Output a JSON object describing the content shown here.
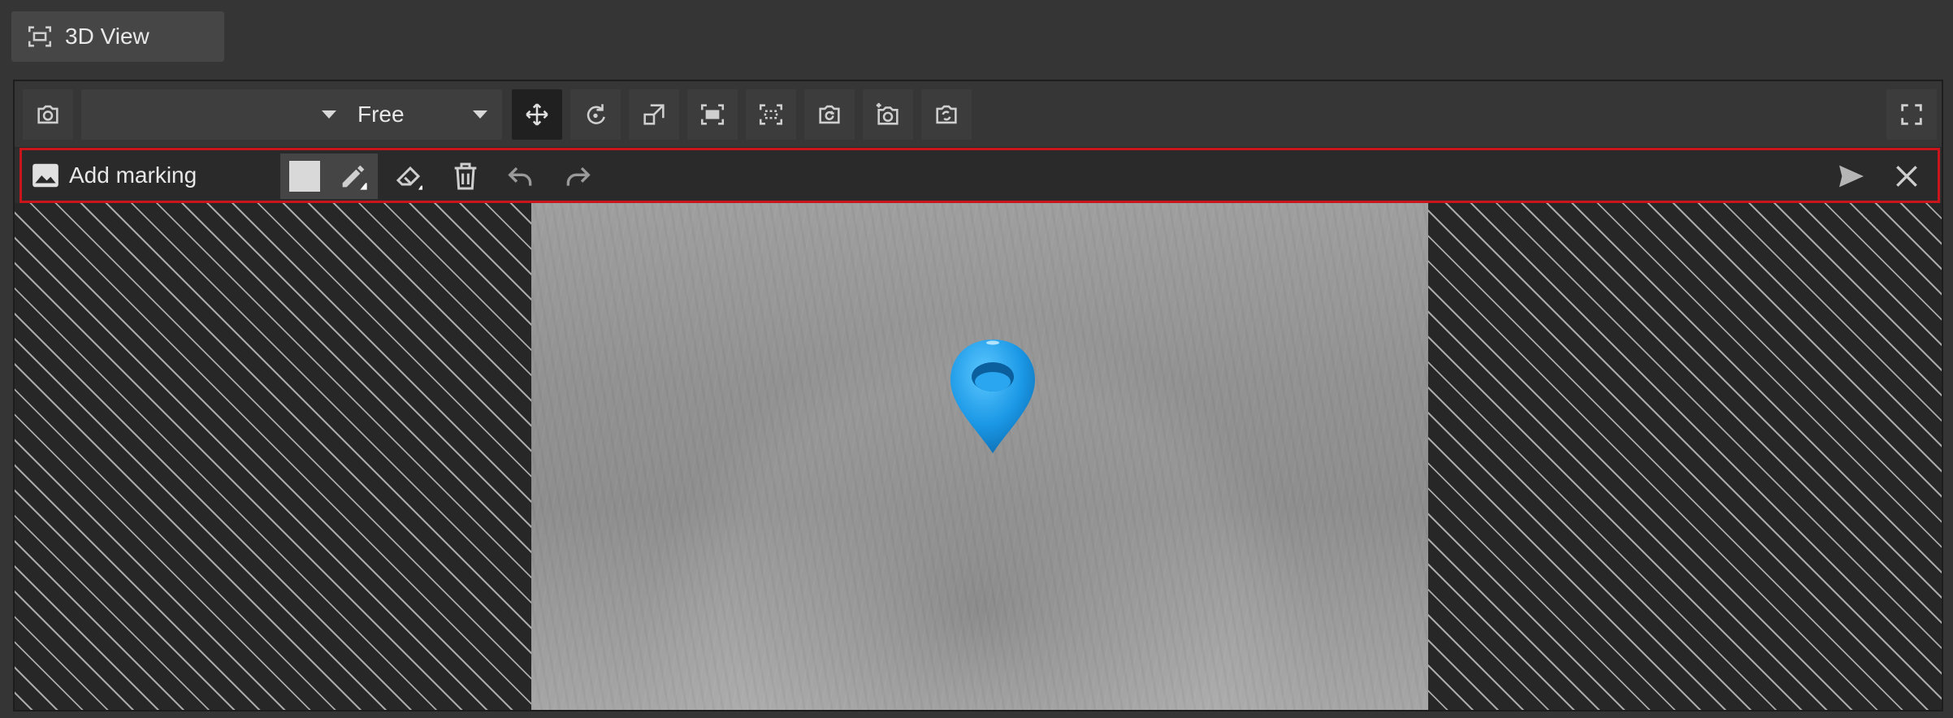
{
  "tab": {
    "title": "3D View",
    "icon": "fit-view-icon"
  },
  "toolbar": {
    "camera_select": {
      "value": "",
      "icon": "chevron-down-icon"
    },
    "mode_select": {
      "value": "Free",
      "icon": "chevron-down-icon"
    },
    "buttons": [
      {
        "name": "camera-icon",
        "active": false
      },
      {
        "name": "move-icon",
        "active": true
      },
      {
        "name": "rotate-icon",
        "active": false
      },
      {
        "name": "resize-icon",
        "active": false
      },
      {
        "name": "fit-view-icon",
        "active": false
      },
      {
        "name": "fit-selection-icon",
        "active": false
      },
      {
        "name": "reset-view-icon",
        "active": false
      },
      {
        "name": "add-snapshot-icon",
        "active": false
      },
      {
        "name": "switch-camera-icon",
        "active": false
      },
      {
        "name": "fullscreen-icon",
        "active": false
      }
    ]
  },
  "marking": {
    "title": "Add marking",
    "title_icon": "image-icon",
    "tools": [
      "color-swatch",
      "pencil-icon",
      "eraser-icon",
      "trash-icon",
      "undo-icon",
      "redo-icon",
      "send-icon",
      "close-icon"
    ],
    "swatch_color": "#d9d9d9",
    "accent": "#c9161d"
  },
  "viewport": {
    "marker_icon": "location-pin-icon",
    "marker_color": "#1e9bea"
  }
}
